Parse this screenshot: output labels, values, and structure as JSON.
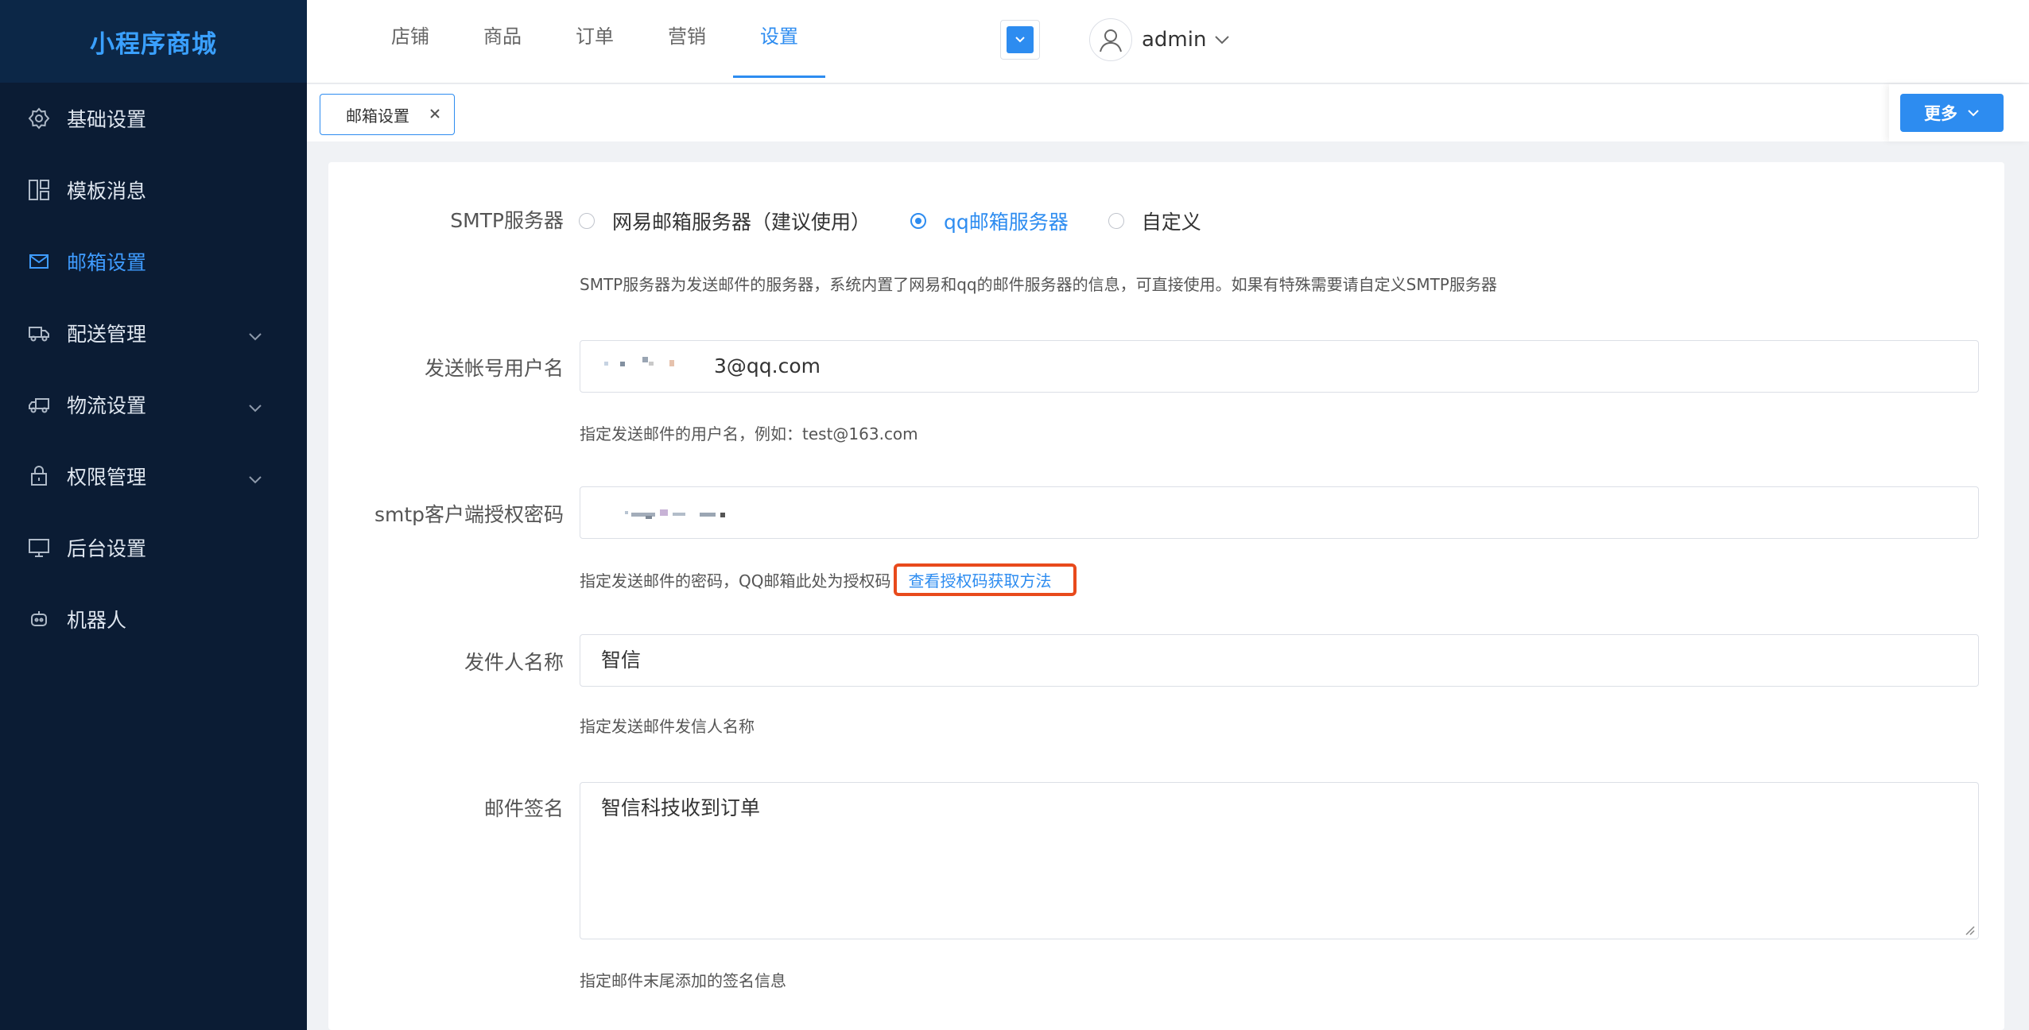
{
  "app": {
    "title": "小程序商城"
  },
  "sidebar": {
    "items": [
      {
        "label": "基础设置",
        "icon": "gear-icon",
        "active": false,
        "expandable": false
      },
      {
        "label": "模板消息",
        "icon": "grid-icon",
        "active": false,
        "expandable": false
      },
      {
        "label": "邮箱设置",
        "icon": "mail-icon",
        "active": true,
        "expandable": false
      },
      {
        "label": "配送管理",
        "icon": "delivery-icon",
        "active": false,
        "expandable": true
      },
      {
        "label": "物流设置",
        "icon": "truck-icon",
        "active": false,
        "expandable": true
      },
      {
        "label": "权限管理",
        "icon": "lock-icon",
        "active": false,
        "expandable": true
      },
      {
        "label": "后台设置",
        "icon": "monitor-icon",
        "active": false,
        "expandable": false
      },
      {
        "label": "机器人",
        "icon": "robot-icon",
        "active": false,
        "expandable": false
      }
    ]
  },
  "topnav": {
    "tabs": [
      "店铺",
      "商品",
      "订单",
      "营销",
      "设置"
    ],
    "active_index": 4,
    "username": "admin"
  },
  "tabbar": {
    "open_tab": "邮箱设置",
    "more_label": "更多"
  },
  "form": {
    "smtp": {
      "label": "SMTP服务器",
      "options": [
        "网易邮箱服务器（建议使用）",
        "qq邮箱服务器",
        "自定义"
      ],
      "selected_index": 1,
      "help": "SMTP服务器为发送邮件的服务器，系统内置了网易和qq的邮件服务器的信息，可直接使用。如果有特殊需要请自定义SMTP服务器"
    },
    "username": {
      "label": "发送帐号用户名",
      "value": "3@qq.com",
      "help": "指定发送邮件的用户名，例如：test@163.com"
    },
    "password": {
      "label": "smtp客户端授权密码",
      "help": "指定发送邮件的密码，QQ邮箱此处为授权码",
      "link": "查看授权码获取方法"
    },
    "sender": {
      "label": "发件人名称",
      "value": "智信",
      "help": "指定发送邮件发信人名称"
    },
    "signature": {
      "label": "邮件签名",
      "value": "智信科技收到订单",
      "help": "指定邮件末尾添加的签名信息"
    }
  },
  "colors": {
    "sidebar_bg": "#0b1c34",
    "accent": "#2d8cf0",
    "highlight_border": "#e84a1c"
  }
}
